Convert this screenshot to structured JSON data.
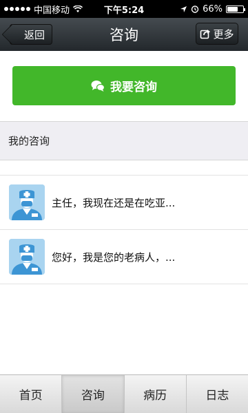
{
  "status_bar": {
    "carrier": "中国移动",
    "time": "下午5:24",
    "battery_percent": "66%",
    "battery_level": 0.66
  },
  "nav": {
    "back_label": "返回",
    "title": "咨询",
    "more_label": "更多"
  },
  "consult_button": {
    "label": "我要咨询"
  },
  "section": {
    "title": "我的咨询"
  },
  "consultations": [
    {
      "preview": "主任，我现在还是在吃亚..."
    },
    {
      "preview": "您好，我是您的老病人，..."
    }
  ],
  "tabs": [
    {
      "label": "首页",
      "active": false
    },
    {
      "label": "咨询",
      "active": true
    },
    {
      "label": "病历",
      "active": false
    },
    {
      "label": "日志",
      "active": false
    }
  ],
  "colors": {
    "accent_green": "#42b72a",
    "nav_dark": "#2b3034",
    "avatar_blue": "#a9d4f0"
  },
  "icons": {
    "back": "chevron-left-icon",
    "more": "share-icon",
    "consult": "chat-bubbles-icon",
    "avatar": "doctor-icon"
  }
}
